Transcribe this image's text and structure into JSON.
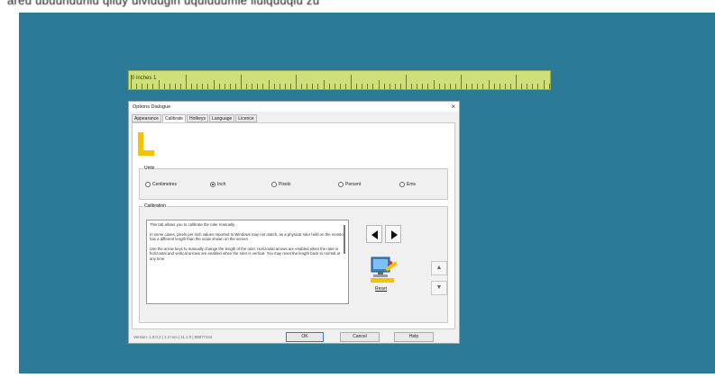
{
  "header_text": "areu ubuunuuniu qiiuy uiviuugin uquiuuumie iiuiquuqiu zu",
  "ruler": {
    "label": "0 inches 1"
  },
  "dialog": {
    "title": "Options Dialogue",
    "close_glyph": "×",
    "tabs": [
      "Appearance",
      "Calibrate",
      "Hotkeys",
      "Language",
      "Licence"
    ],
    "units": {
      "legend": "Units",
      "options": [
        "Centimetres",
        "Inch",
        "Pixels",
        "Percent",
        "Ems"
      ],
      "selected": "Inch"
    },
    "calibration": {
      "legend": "Calibration",
      "paragraphs": [
        "This tab allows you to calibrate the ruler manually.",
        "In some cases, pixels per inch values reported to Windows may not match, as a physical ruler held on the monitor has a different length than the scale shown on the screen.",
        "Use the arrow keys to manually change the length of the ruler. Horizontal arrows are enabled when the ruler is horizontal and vertical arrows are enabled when the ruler is vertical. You may reset the length back to normal at any time."
      ],
      "reset_label": "Reset",
      "spin_up": "▲",
      "spin_down": "▼"
    },
    "status_text": "Version: 1.0.0.2 | 1.2 mm | 11.1.0 | 88877444",
    "buttons": {
      "ok": "OK",
      "cancel": "Cancel",
      "help": "Help"
    }
  },
  "colors": {
    "desktop": "#2b7b98",
    "ruler": "#cfe07a",
    "accent": "#f2c400"
  }
}
